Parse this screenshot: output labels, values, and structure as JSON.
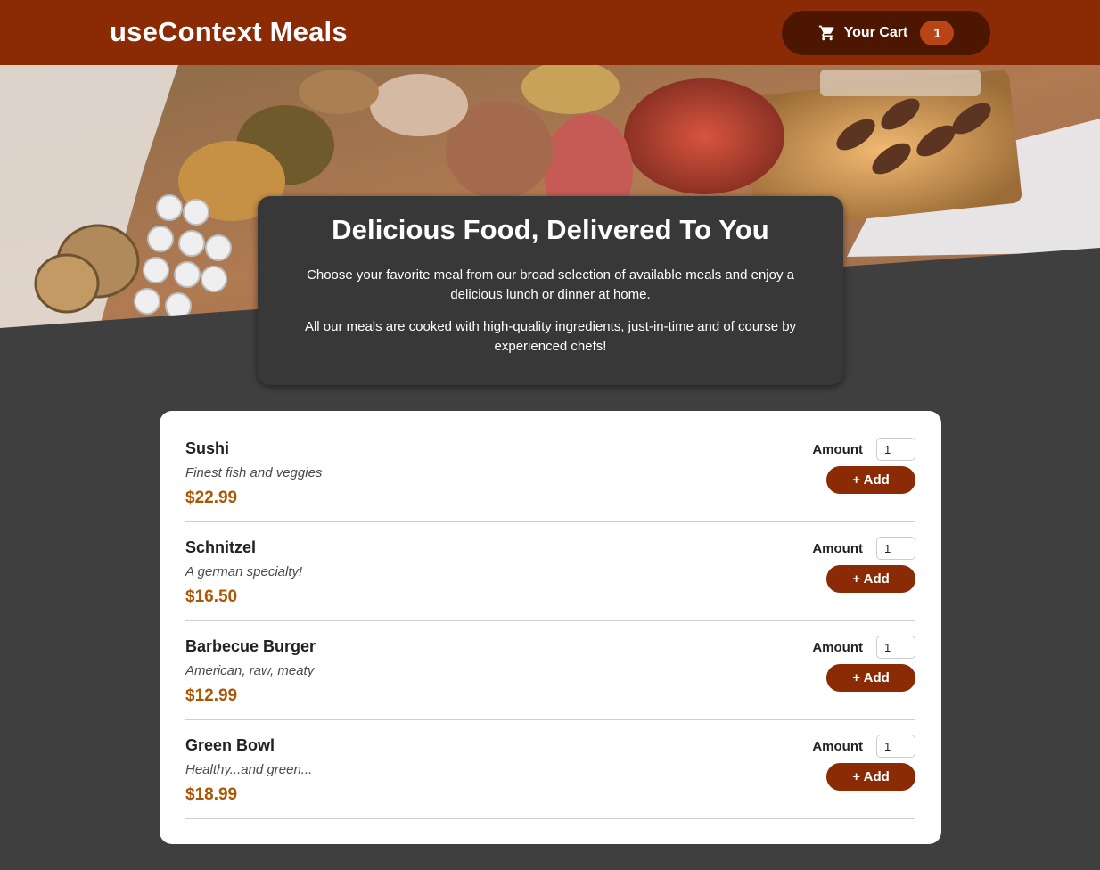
{
  "header": {
    "brand": "useContext Meals",
    "cart_label": "Your Cart",
    "cart_count": "1",
    "cart_icon": "shopping-cart-icon"
  },
  "hero": {
    "image": "banquet-buffet-table-photo"
  },
  "summary": {
    "title": "Delicious Food, Delivered To You",
    "paragraph_1": "Choose your favorite meal from our broad selection of available meals and enjoy a delicious lunch or dinner at home.",
    "paragraph_2": "All our meals are cooked with high-quality ingredients, just-in-time and of course by experienced chefs!"
  },
  "meals": {
    "amount_label": "Amount",
    "add_label": "+ Add",
    "items": [
      {
        "name": "Sushi",
        "description": "Finest fish and veggies",
        "price": "$22.99",
        "amount": "1"
      },
      {
        "name": "Schnitzel",
        "description": "A german specialty!",
        "price": "$16.50",
        "amount": "1"
      },
      {
        "name": "Barbecue Burger",
        "description": "American, raw, meaty",
        "price": "$12.99",
        "amount": "1"
      },
      {
        "name": "Green Bowl",
        "description": "Healthy...and green...",
        "price": "$18.99",
        "amount": "1"
      }
    ]
  },
  "colors": {
    "header_bg": "#8a2b06",
    "cart_button_bg": "#4d1601",
    "badge_bg": "#b94517",
    "page_bg": "#3f3f3f",
    "price": "#ad5502"
  }
}
